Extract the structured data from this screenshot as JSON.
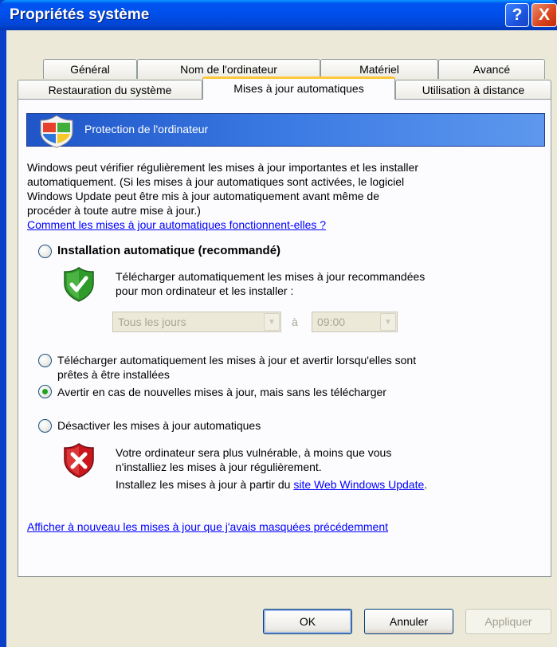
{
  "window": {
    "title": "Propriétés système",
    "help_glyph": "?",
    "close_glyph": "X"
  },
  "tabs": {
    "row1": [
      "Général",
      "Nom de l'ordinateur",
      "Matériel",
      "Avancé"
    ],
    "row2": [
      "Restauration du système",
      "Mises à jour automatiques",
      "Utilisation à distance"
    ],
    "active": "Mises à jour automatiques"
  },
  "banner": {
    "icon": "windows-security-shield-icon",
    "title": "Protection de l'ordinateur"
  },
  "intro": {
    "lines": [
      "Windows peut vérifier régulièrement les mises à jour importantes et les installer",
      "automatiquement. (Si les mises à jour automatiques sont activées, le logiciel",
      "Windows Update peut être mis à jour automatiquement avant même de",
      "procéder à toute autre mise à jour.)"
    ],
    "link": "Comment les mises à jour automatiques fonctionnent-elles ?"
  },
  "options": {
    "auto_install": {
      "label": "Installation automatique (recommandé)",
      "checked": false,
      "icon": "green-shield-check-icon",
      "desc_lines": [
        "Télécharger automatiquement les mises à jour recommandées",
        "pour mon ordinateur et les installer :"
      ],
      "frequency": "Tous les jours",
      "at": "à",
      "time": "09:00"
    },
    "download_notify": {
      "label_lines": [
        "Télécharger automatiquement les mises à jour et avertir lorsqu'elles sont",
        "prêtes à être installées"
      ],
      "checked": false
    },
    "notify_only": {
      "label": "Avertir en cas de nouvelles mises à jour, mais sans les télécharger",
      "checked": true
    },
    "disable": {
      "label": "Désactiver les mises à jour automatiques",
      "checked": false,
      "icon": "red-shield-x-icon",
      "warn_lines": [
        "Votre ordinateur sera plus vulnérable, à moins que vous",
        "n'installiez les mises à jour régulièrement."
      ],
      "install_prefix": "Installez les mises à jour à partir du ",
      "install_link": "site Web Windows Update",
      "install_suffix": "."
    }
  },
  "hidden_updates_link": "Afficher à nouveau les mises à jour que j'avais masquées précédemment",
  "buttons": {
    "ok": "OK",
    "cancel": "Annuler",
    "apply": "Appliquer"
  },
  "colors": {
    "title_bar": "#0053ee",
    "dialog_bg": "#ece9d8",
    "link": "#0000ff",
    "active_tab_accent": "#ffc83c"
  }
}
